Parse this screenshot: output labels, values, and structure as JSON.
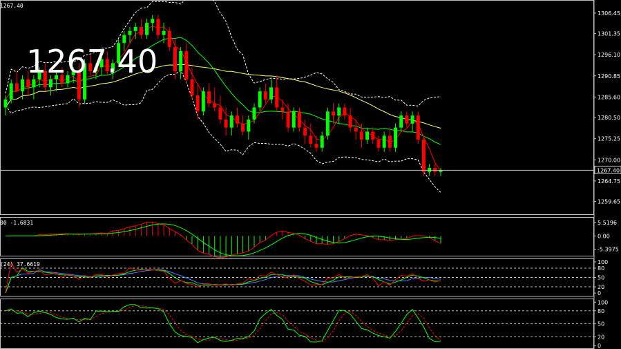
{
  "header": {
    "symbol_price": "1267.40",
    "big_price": "1267.40"
  },
  "colors": {
    "background": "#000000",
    "bull": "#00ff00",
    "bear": "#ff0000",
    "ma_fast": "#ff0000",
    "ma_mid": "#00ff00",
    "ma_slow": "#ffff66",
    "band": "#ffffff",
    "current_line": "#c0c0c0"
  },
  "chart_data": [
    {
      "type": "candlestick",
      "panel": "price",
      "ylim": [
        1257.0,
        1309.0
      ],
      "yticks": [
        "1306.45",
        "1301.35",
        "1296.10",
        "1290.85",
        "1285.60",
        "1280.50",
        "1275.25",
        "1270.00",
        "1264.75",
        "1259.65"
      ],
      "ytick_values": [
        1306.45,
        1301.35,
        1296.1,
        1290.85,
        1285.6,
        1280.5,
        1275.25,
        1270.0,
        1264.75,
        1259.65
      ],
      "current_price_label": "1267.40",
      "current_price": 1267.4,
      "candles_ohlc": [
        [
          1283,
          1286,
          1281,
          1285
        ],
        [
          1285,
          1290,
          1284,
          1289
        ],
        [
          1289,
          1292,
          1287,
          1287
        ],
        [
          1287,
          1291,
          1285,
          1290
        ],
        [
          1290,
          1292,
          1286,
          1288
        ],
        [
          1288,
          1291,
          1285,
          1290
        ],
        [
          1290,
          1293,
          1288,
          1292
        ],
        [
          1292,
          1294,
          1287,
          1288
        ],
        [
          1288,
          1291,
          1286,
          1290
        ],
        [
          1290,
          1292,
          1287,
          1291
        ],
        [
          1291,
          1293,
          1288,
          1289
        ],
        [
          1289,
          1292,
          1288,
          1291
        ],
        [
          1291,
          1293,
          1289,
          1292
        ],
        [
          1292,
          1294,
          1283,
          1285
        ],
        [
          1285,
          1295,
          1284,
          1294
        ],
        [
          1294,
          1296,
          1291,
          1292
        ],
        [
          1292,
          1294,
          1290,
          1293
        ],
        [
          1293,
          1296,
          1291,
          1295
        ],
        [
          1295,
          1297,
          1291,
          1292
        ],
        [
          1292,
          1295,
          1290,
          1294
        ],
        [
          1294,
          1300,
          1293,
          1299
        ],
        [
          1299,
          1302,
          1297,
          1301
        ],
        [
          1301,
          1303,
          1299,
          1302
        ],
        [
          1302,
          1304,
          1300,
          1303
        ],
        [
          1303,
          1305,
          1300,
          1301
        ],
        [
          1301,
          1305,
          1300,
          1304
        ],
        [
          1304,
          1306,
          1302,
          1305
        ],
        [
          1305,
          1306,
          1300,
          1301
        ],
        [
          1301,
          1304,
          1299,
          1302
        ],
        [
          1302,
          1303,
          1297,
          1298
        ],
        [
          1298,
          1300,
          1290,
          1292
        ],
        [
          1292,
          1298,
          1290,
          1297
        ],
        [
          1297,
          1299,
          1289,
          1290
        ],
        [
          1290,
          1293,
          1285,
          1286
        ],
        [
          1286,
          1289,
          1280,
          1282
        ],
        [
          1282,
          1288,
          1281,
          1287
        ],
        [
          1287,
          1289,
          1283,
          1284
        ],
        [
          1284,
          1288,
          1282,
          1283
        ],
        [
          1283,
          1286,
          1279,
          1280
        ],
        [
          1280,
          1283,
          1276,
          1278
        ],
        [
          1278,
          1282,
          1276,
          1281
        ],
        [
          1281,
          1283,
          1278,
          1279
        ],
        [
          1279,
          1281,
          1276,
          1277
        ],
        [
          1277,
          1281,
          1275,
          1280
        ],
        [
          1280,
          1284,
          1279,
          1283
        ],
        [
          1283,
          1288,
          1282,
          1287
        ],
        [
          1287,
          1289,
          1284,
          1285
        ],
        [
          1285,
          1290,
          1284,
          1288
        ],
        [
          1288,
          1291,
          1282,
          1283
        ],
        [
          1283,
          1285,
          1280,
          1282
        ],
        [
          1282,
          1284,
          1277,
          1278
        ],
        [
          1278,
          1283,
          1277,
          1282
        ],
        [
          1282,
          1283,
          1277,
          1278
        ],
        [
          1278,
          1280,
          1274,
          1276
        ],
        [
          1276,
          1279,
          1273,
          1274
        ],
        [
          1274,
          1276,
          1272,
          1273
        ],
        [
          1273,
          1277,
          1272,
          1276
        ],
        [
          1276,
          1283,
          1275,
          1282
        ],
        [
          1282,
          1284,
          1279,
          1281
        ],
        [
          1281,
          1284,
          1279,
          1283
        ],
        [
          1283,
          1284,
          1280,
          1281
        ],
        [
          1281,
          1283,
          1277,
          1278
        ],
        [
          1278,
          1280,
          1275,
          1277
        ],
        [
          1277,
          1279,
          1273,
          1275
        ],
        [
          1275,
          1278,
          1274,
          1277
        ],
        [
          1277,
          1278,
          1274,
          1275
        ],
        [
          1275,
          1276,
          1272,
          1273
        ],
        [
          1273,
          1277,
          1272,
          1276
        ],
        [
          1276,
          1278,
          1272,
          1273
        ],
        [
          1273,
          1279,
          1272,
          1278
        ],
        [
          1278,
          1282,
          1277,
          1281
        ],
        [
          1281,
          1282,
          1278,
          1279
        ],
        [
          1279,
          1282,
          1277,
          1281
        ],
        [
          1281,
          1282,
          1274,
          1275
        ],
        [
          1275,
          1276,
          1266,
          1267
        ],
        [
          1267,
          1269,
          1266,
          1268
        ],
        [
          1268,
          1269,
          1266,
          1267
        ],
        [
          1267,
          1268,
          1266,
          1267.4
        ]
      ]
    },
    {
      "type": "histogram",
      "panel": "macd",
      "ylim": [
        -7.2,
        6.6
      ],
      "yticks": [
        "5.5196",
        "0.00",
        "-5.3975"
      ],
      "ytick_values": [
        5.5196,
        0.0,
        -5.3975
      ],
      "label": "00 -1.6831"
    },
    {
      "type": "line",
      "panel": "rsi",
      "ylim": [
        -2,
        102
      ],
      "yticks": [
        "100",
        "80",
        "50",
        "20",
        "0"
      ],
      "ytick_values": [
        100,
        80,
        50,
        20,
        0
      ],
      "label": "(24) 37.6619",
      "levels": [
        80,
        50,
        20
      ]
    },
    {
      "type": "line",
      "panel": "stochastic",
      "ylim": [
        -2,
        102
      ],
      "yticks": [
        "100",
        "80",
        "50",
        "20",
        "0"
      ],
      "ytick_values": [
        100,
        80,
        50,
        20,
        0
      ],
      "levels": [
        80,
        50,
        20
      ]
    }
  ]
}
